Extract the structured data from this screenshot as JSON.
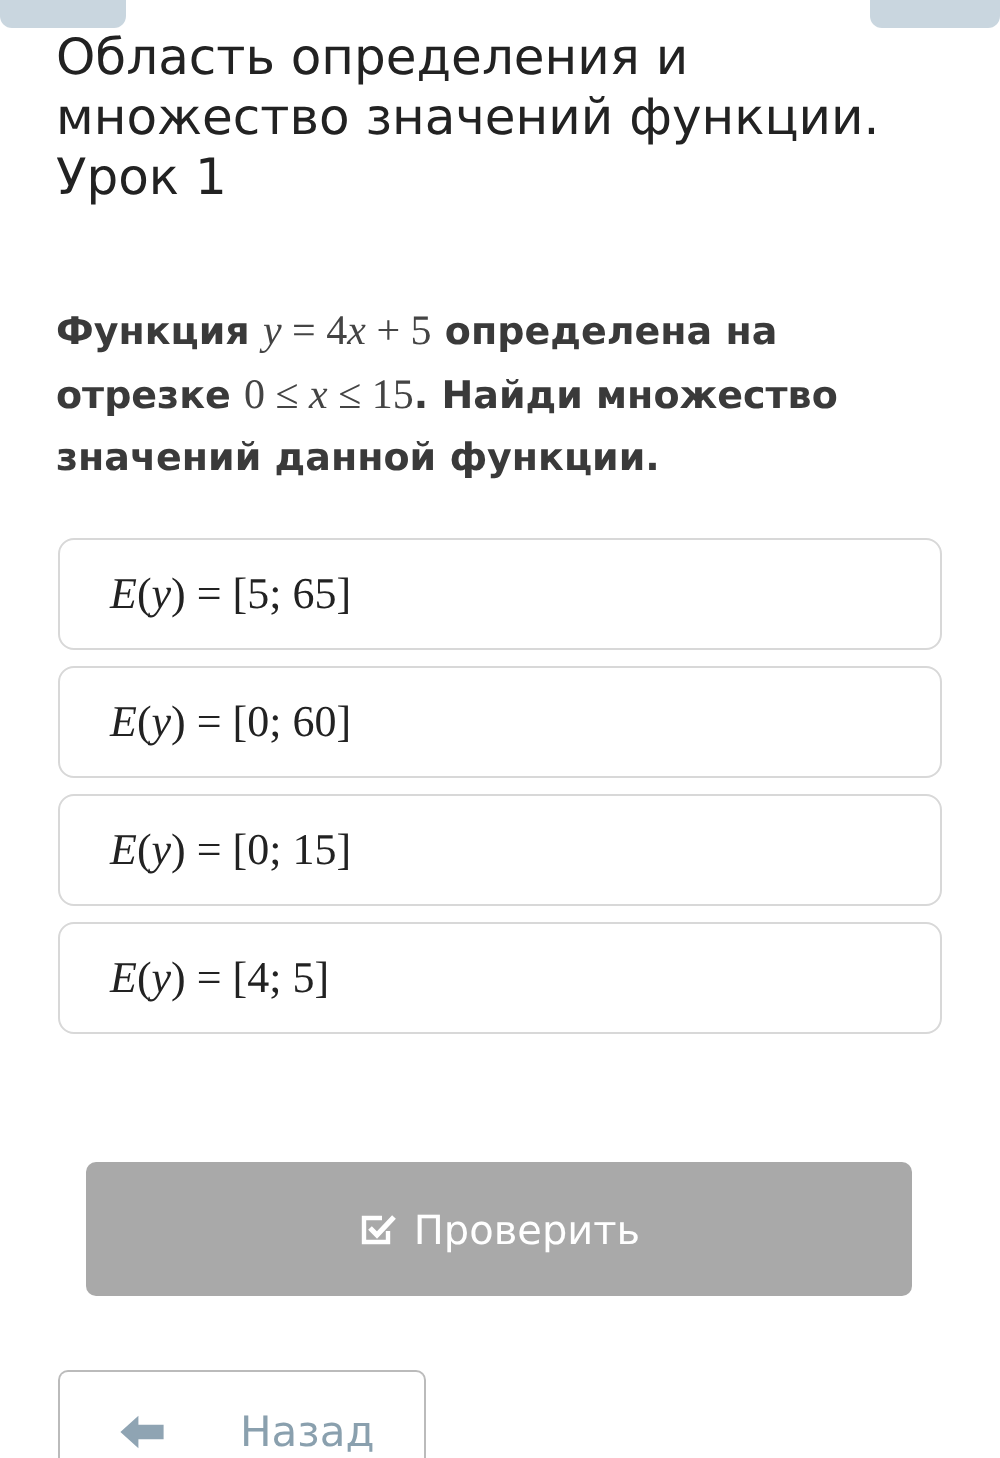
{
  "title": "Область определения и множество значений функции. Урок 1",
  "question": [
    {
      "kind": "text",
      "text": "Функция "
    },
    {
      "kind": "math",
      "text": "*y* = 4"
    },
    {
      "kind": "math",
      "text": "*x* + 5"
    },
    {
      "kind": "text",
      "text": " определена на отрезке "
    },
    {
      "kind": "math",
      "text": "0 ≤ *x* ≤ 15"
    },
    {
      "kind": "text",
      "text": ". Найди множество значений данной функции."
    }
  ],
  "options": [
    {
      "text": "*E*(*y*) = [5; 65]",
      "selected": false
    },
    {
      "text": "*E*(*y*) = [0; 60]",
      "selected": false
    },
    {
      "text": "*E*(*y*) = [0; 15]",
      "selected": false
    },
    {
      "text": "*E*(*y*) = [4; 5]",
      "selected": false
    }
  ],
  "check_button": {
    "label": "Проверить",
    "disabled": true
  },
  "back_button": {
    "label": "Назад"
  }
}
